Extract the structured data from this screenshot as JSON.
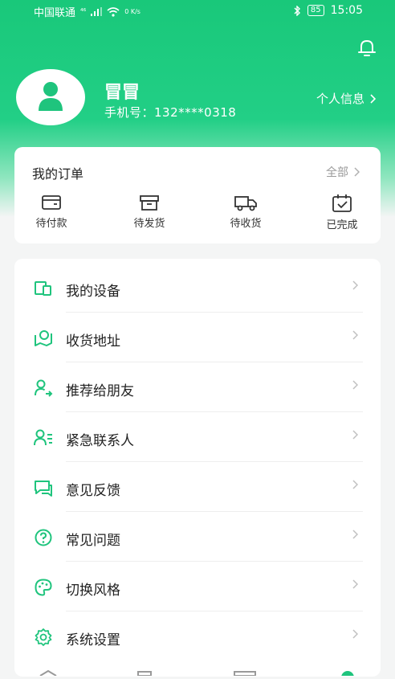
{
  "status_bar": {
    "carrier": "中国联通",
    "network": "⁴⁶",
    "speed": "0 K/s",
    "battery": "85",
    "time": "15:05"
  },
  "profile": {
    "name": "冒冒",
    "phone_label": "手机号：",
    "phone": "132****0318",
    "info_link": "个人信息"
  },
  "orders": {
    "title": "我的订单",
    "all_label": "全部",
    "items": [
      {
        "label": "待付款",
        "icon": "wallet-icon"
      },
      {
        "label": "待发货",
        "icon": "box-icon"
      },
      {
        "label": "待收货",
        "icon": "truck-icon"
      },
      {
        "label": "已完成",
        "icon": "calendar-check-icon"
      }
    ]
  },
  "menu": {
    "items": [
      {
        "label": "我的设备",
        "icon": "device-icon"
      },
      {
        "label": "收货地址",
        "icon": "map-pin-icon"
      },
      {
        "label": "推荐给朋友",
        "icon": "share-user-icon"
      },
      {
        "label": "紧急联系人",
        "icon": "contact-list-icon"
      },
      {
        "label": "意见反馈",
        "icon": "feedback-icon"
      },
      {
        "label": "常见问题",
        "icon": "question-icon"
      },
      {
        "label": "切换风格",
        "icon": "palette-icon"
      },
      {
        "label": "系统设置",
        "icon": "gear-icon"
      }
    ]
  },
  "colors": {
    "accent": "#1fc47d",
    "text": "#222222",
    "muted": "#9a9a9a"
  }
}
